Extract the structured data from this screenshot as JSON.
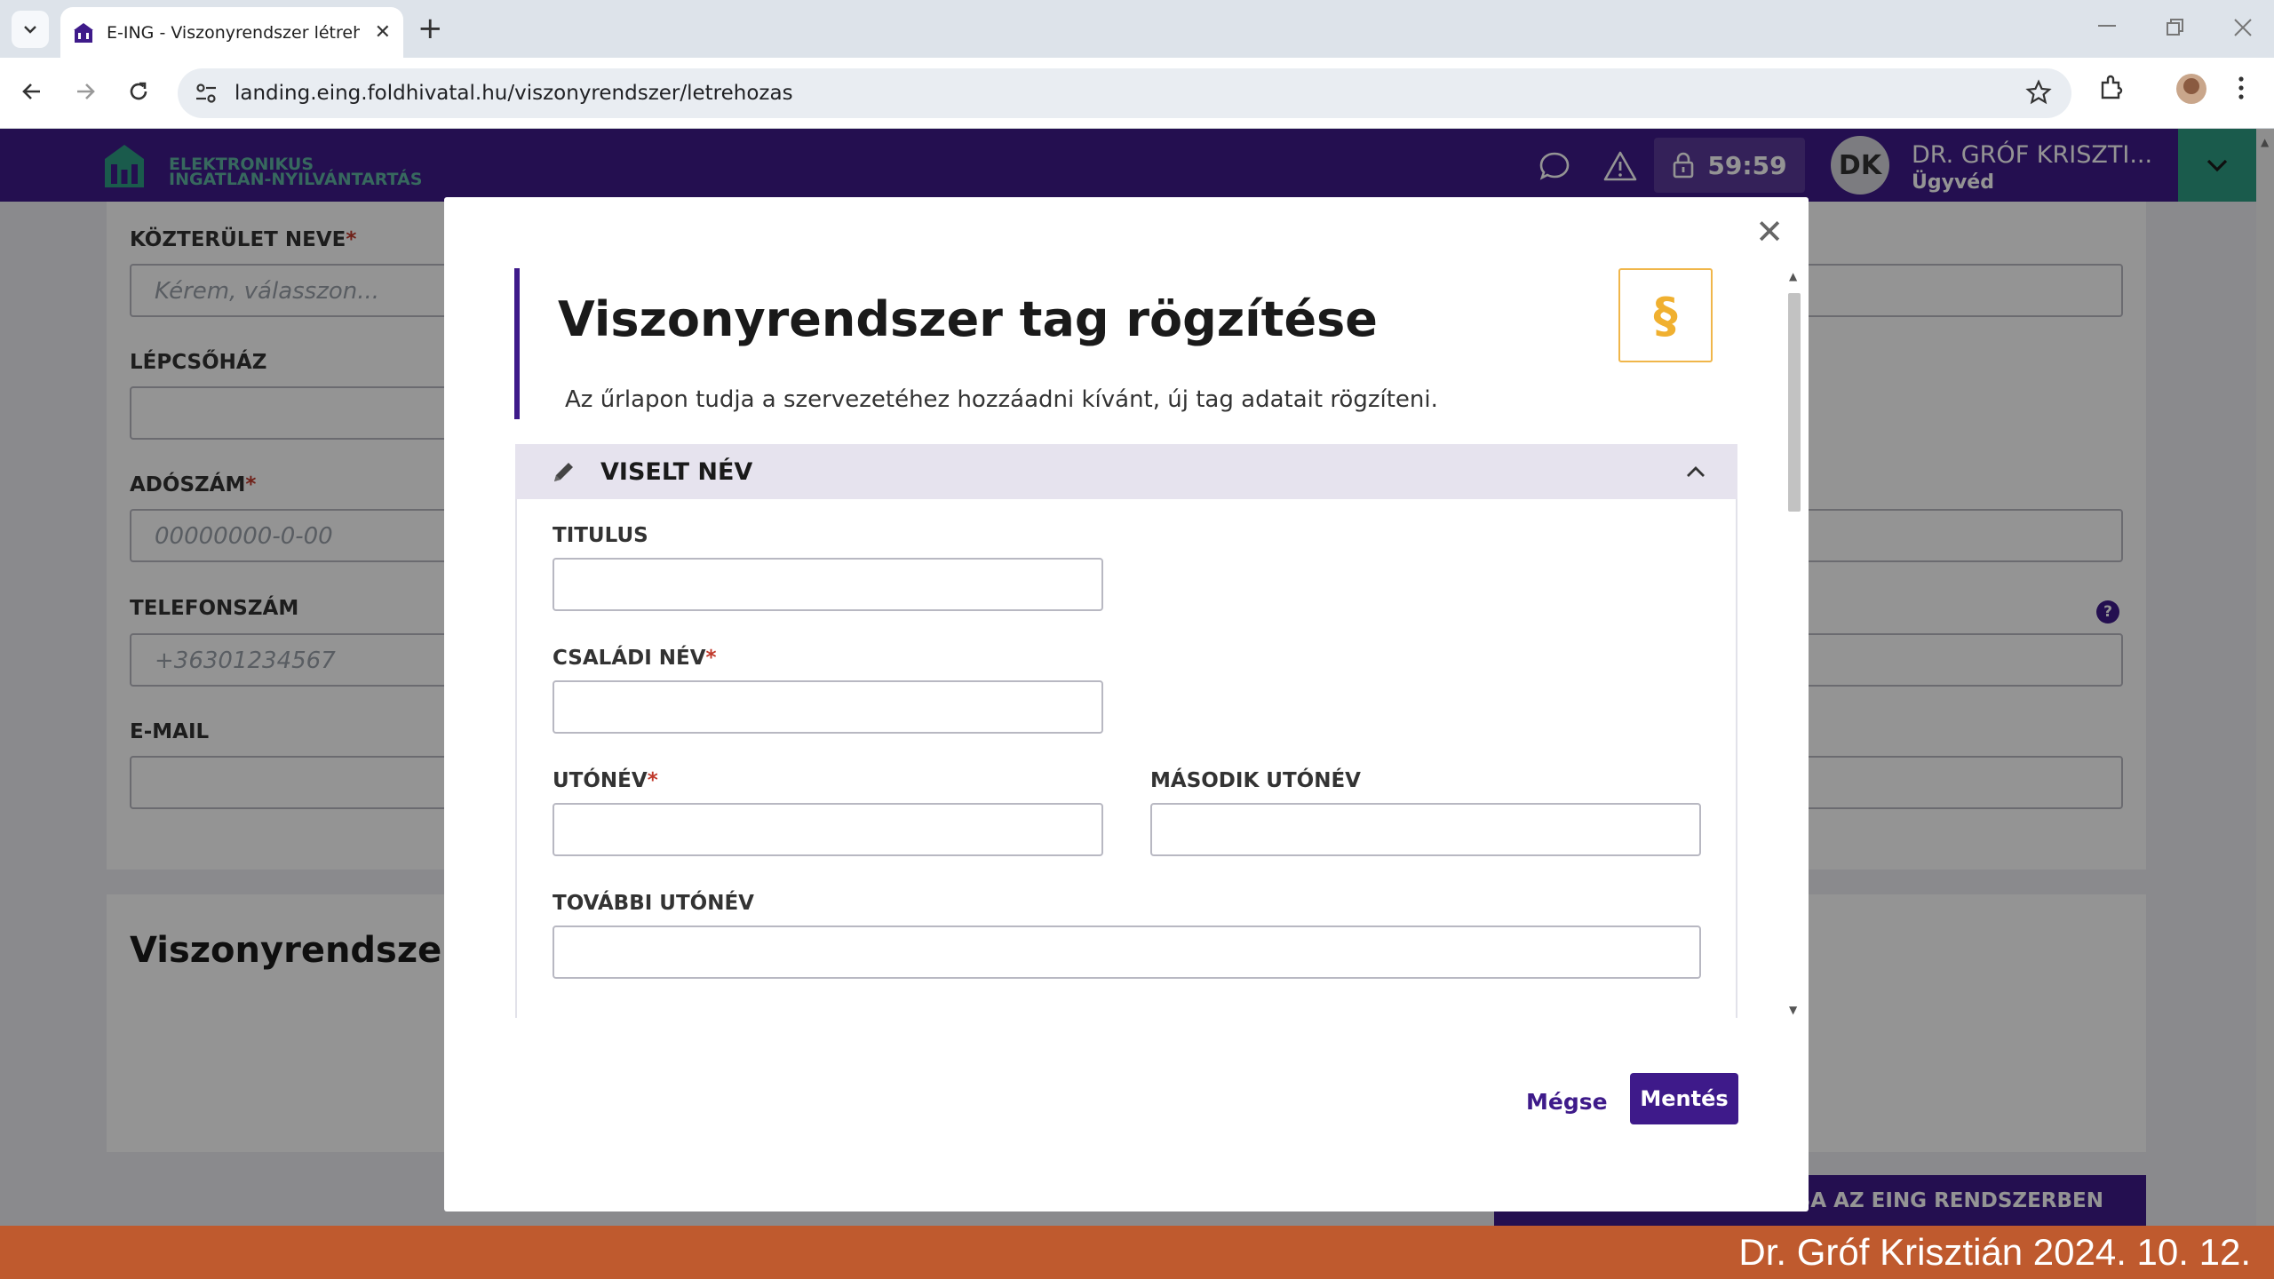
{
  "browser": {
    "tab_title": "E-ING - Viszonyrendszer létrehozása",
    "url": "landing.eing.foldhivatal.hu/viszonyrendszer/letrehozas",
    "new_tab": "+",
    "tab_close": "✕"
  },
  "header": {
    "logo_line1": "ELEKTRONIKUS",
    "logo_line2": "INGATLAN-NYILVÁNTARTÁS",
    "timer": "59:59",
    "avatar_initials": "DK",
    "user_name": "DR. GRÓF KRISZTI...",
    "user_role": "Ügyvéd",
    "colors": {
      "primary": "#3e1a8a",
      "accent_green": "#2e9e84"
    }
  },
  "background_form": {
    "fields": [
      {
        "label": "KÖZTERÜLET NEVE",
        "required": true,
        "placeholder": "Kérem, válasszon..."
      },
      {
        "label": "LÉPCSŐHÁZ",
        "required": false,
        "placeholder": ""
      },
      {
        "label": "ADÓSZÁM",
        "required": true,
        "placeholder": "00000000-0-00"
      },
      {
        "label": "TELEFONSZÁM",
        "required": false,
        "placeholder": "+36301234567"
      },
      {
        "label": "E-MAIL",
        "required": false,
        "placeholder": ""
      }
    ],
    "section2_title": "Viszonyrendszer k",
    "cta_label": "OZÁSA AZ EING RENDSZERBEN",
    "help_icon": "?"
  },
  "modal": {
    "title": "Viszonyrendszer tag rögzítése",
    "subtitle": "Az űrlapon tudja a szervezetéhez hozzáadni kívánt, új tag adatait rögzíteni.",
    "paragraph_icon": "§",
    "close": "✕",
    "section": {
      "title": "VISELT NÉV",
      "fields": {
        "titulus": "TITULUS",
        "csaladi_nev": "CSALÁDI NÉV",
        "utonev": "UTÓNÉV",
        "masodik_utonev": "MÁSODIK UTÓNÉV",
        "tovabbi_utonev": "TOVÁBBI UTÓNÉV"
      },
      "required_mark": "*"
    },
    "cancel_label": "Mégse",
    "save_label": "Mentés"
  },
  "footer": {
    "text": "Dr. Gróf Krisztián 2024. 10. 12.",
    "color": "#bf5a2e"
  }
}
